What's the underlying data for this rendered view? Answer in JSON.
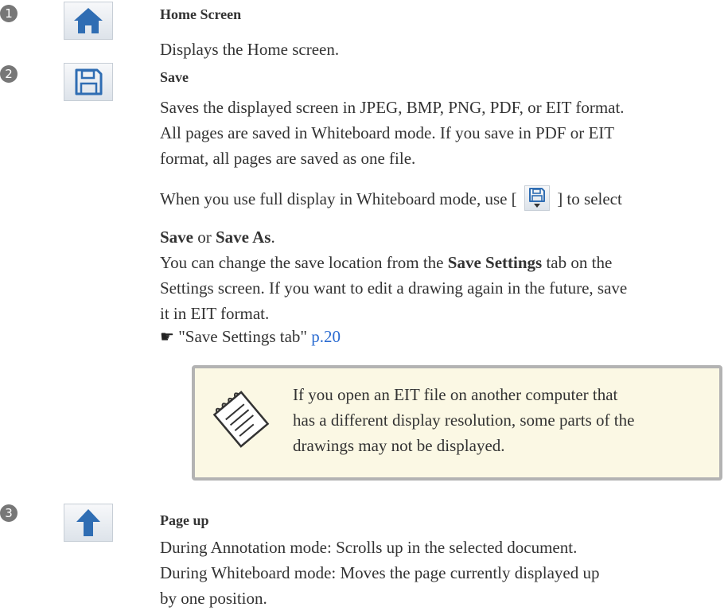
{
  "items": [
    {
      "number": "1",
      "icon": "home-icon",
      "title": "Home Screen",
      "description": "Displays the Home screen."
    },
    {
      "number": "2",
      "icon": "save-icon",
      "title": "Save",
      "p1_lines": [
        "Saves the displayed screen in JPEG, BMP, PNG, PDF, or EIT format.",
        "All pages are saved in Whiteboard mode. If you save in PDF or EIT",
        "format, all pages are saved as one file."
      ],
      "p2_before": "When you use full display in Whiteboard mode, use [",
      "p2_after": "] to select",
      "save_word": "Save",
      "or_word": " or ",
      "save_as_word": "Save As",
      "period": ".",
      "p3_prefix": "You can change the save location from the ",
      "p3_bold": "Save Settings",
      "p3_suffix": " tab on the",
      "p3_lines": [
        "Settings screen. If you want to edit a drawing again in the future, save",
        "it in EIT format."
      ],
      "ref_text": "\"Save Settings tab\"",
      "ref_page": "p.20",
      "note_lines": [
        "If you open an EIT file on another computer that",
        "has a different display resolution, some parts of the",
        "drawings may not be displayed."
      ]
    },
    {
      "number": "3",
      "icon": "arrow-up-icon",
      "title": "Page up",
      "lines": [
        "During Annotation mode: Scrolls up in the selected document.",
        "During Whiteboard mode: Moves the page currently displayed up",
        "by one position."
      ]
    }
  ],
  "colors": {
    "icon_blue": "#2f6db3",
    "link": "#2a6bd1",
    "note_bg": "#fbf8e4"
  }
}
